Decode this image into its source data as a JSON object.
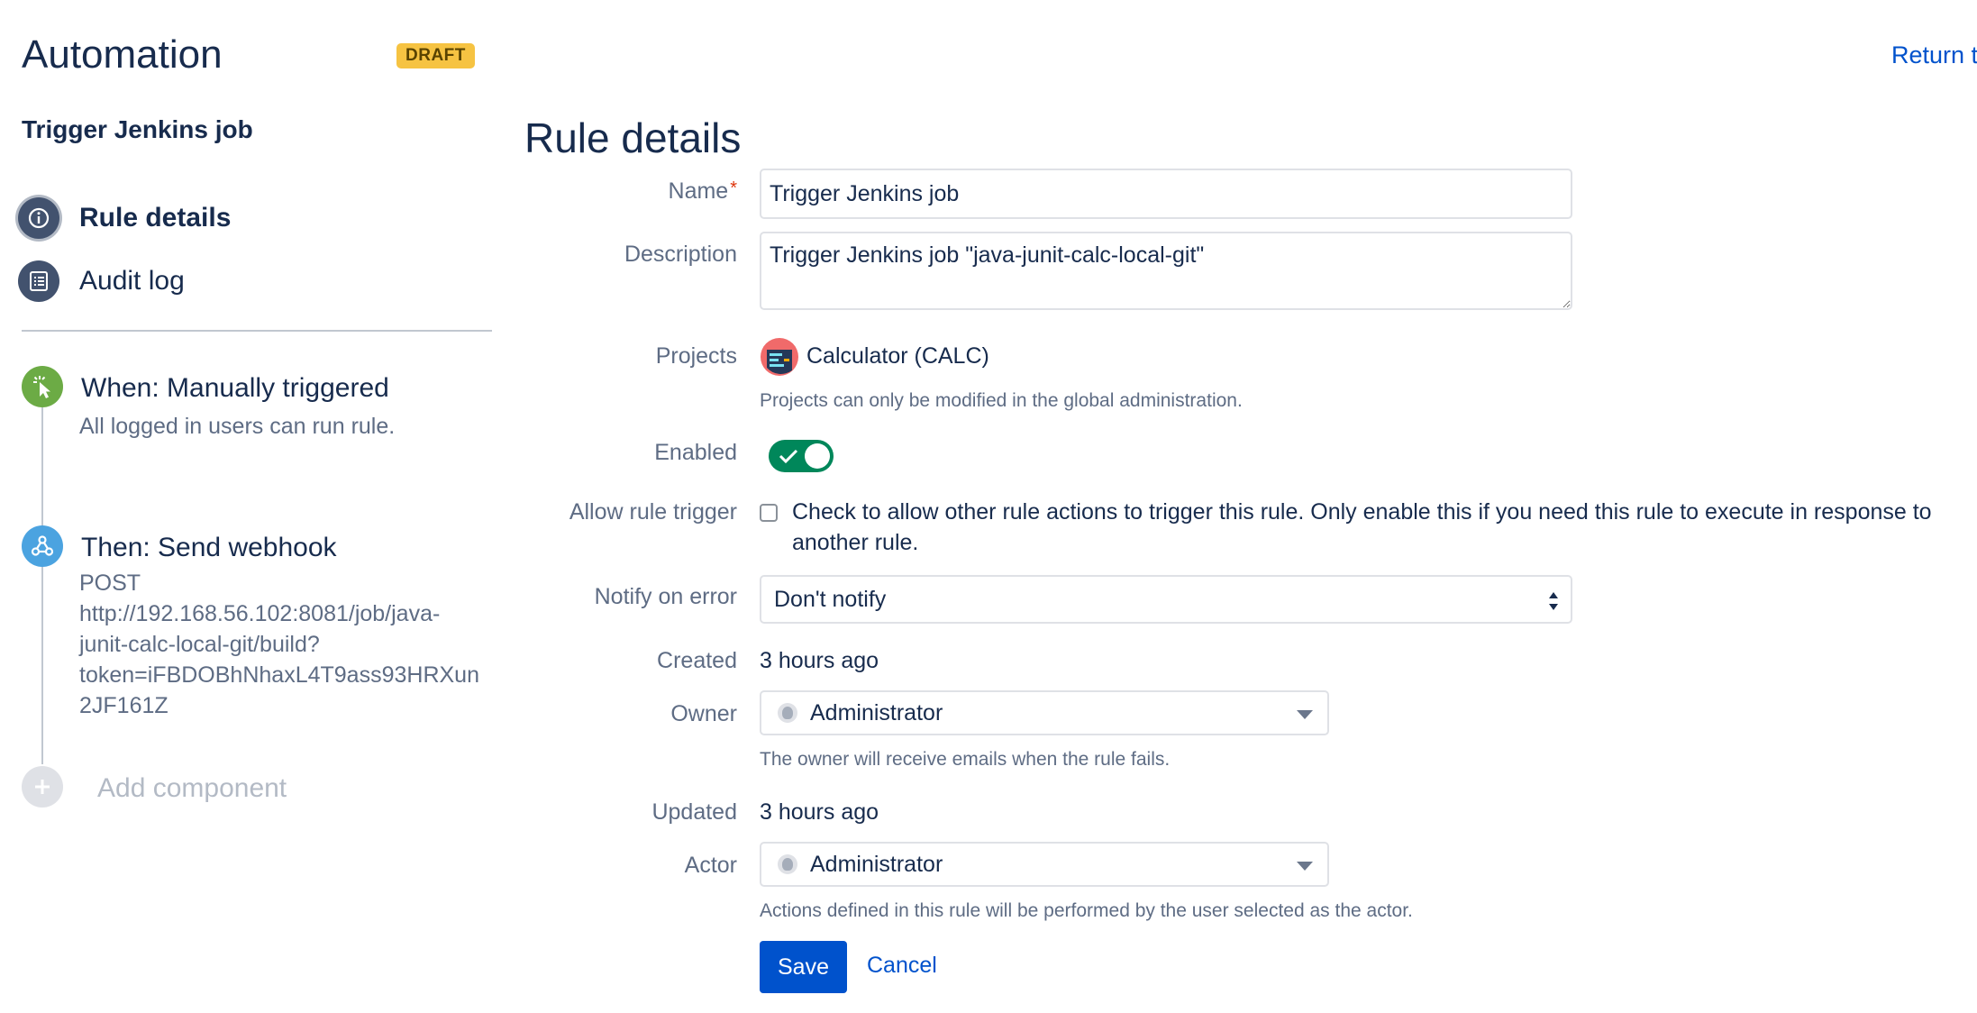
{
  "header": {
    "title": "Automation",
    "badge": "DRAFT",
    "return_link": "Return to list"
  },
  "sidebar": {
    "rule_name": "Trigger Jenkins job",
    "nav": [
      {
        "label": "Rule details",
        "icon": "info-icon",
        "active": true
      },
      {
        "label": "Audit log",
        "icon": "list-icon",
        "active": false
      }
    ],
    "trigger": {
      "title": "When: Manually triggered",
      "description": "All logged in users can run rule.",
      "icon": "manual-trigger-icon",
      "color": "#6cab45"
    },
    "action": {
      "title": "Then: Send webhook",
      "description": "POST http://192.168.56.102:8081/job/java-junit-calc-local-git/build?token=iFBDOBhNhaxL4T9ass93HRXun2JF161Z",
      "description_lines": [
        "POST",
        "http://192.168.56.102:8081/job/java-",
        "junit-calc-local-git/build?",
        "token=iFBDOBhNhaxL4T9ass93HRXun",
        "2JF161Z"
      ],
      "icon": "webhook-icon",
      "color": "#4ba3e0"
    },
    "add_component": "Add component"
  },
  "form": {
    "section_title": "Rule details",
    "name": {
      "label": "Name",
      "required_mark": "*",
      "value": "Trigger Jenkins job"
    },
    "description": {
      "label": "Description",
      "value": "Trigger Jenkins job \"java-junit-calc-local-git\""
    },
    "projects": {
      "label": "Projects",
      "value": "Calculator (CALC)",
      "help": "Projects can only be modified in the global administration."
    },
    "enabled": {
      "label": "Enabled",
      "on": true
    },
    "allow_rule_trigger": {
      "label": "Allow rule trigger",
      "checked": false,
      "text": "Check to allow other rule actions to trigger this rule. Only enable this if you need this rule to execute in response to another rule."
    },
    "notify_on_error": {
      "label": "Notify on error",
      "value": "Don't notify"
    },
    "created": {
      "label": "Created",
      "value": "3 hours ago"
    },
    "owner": {
      "label": "Owner",
      "value": "Administrator",
      "help": "The owner will receive emails when the rule fails."
    },
    "updated": {
      "label": "Updated",
      "value": "3 hours ago"
    },
    "actor": {
      "label": "Actor",
      "value": "Administrator",
      "help": "Actions defined in this rule will be performed by the user selected as the actor."
    },
    "save_label": "Save",
    "cancel_label": "Cancel"
  },
  "colors": {
    "primary": "#0052cc",
    "toggle_on": "#00875a",
    "badge": "#f6c342",
    "nav_icon": "#42526e"
  }
}
